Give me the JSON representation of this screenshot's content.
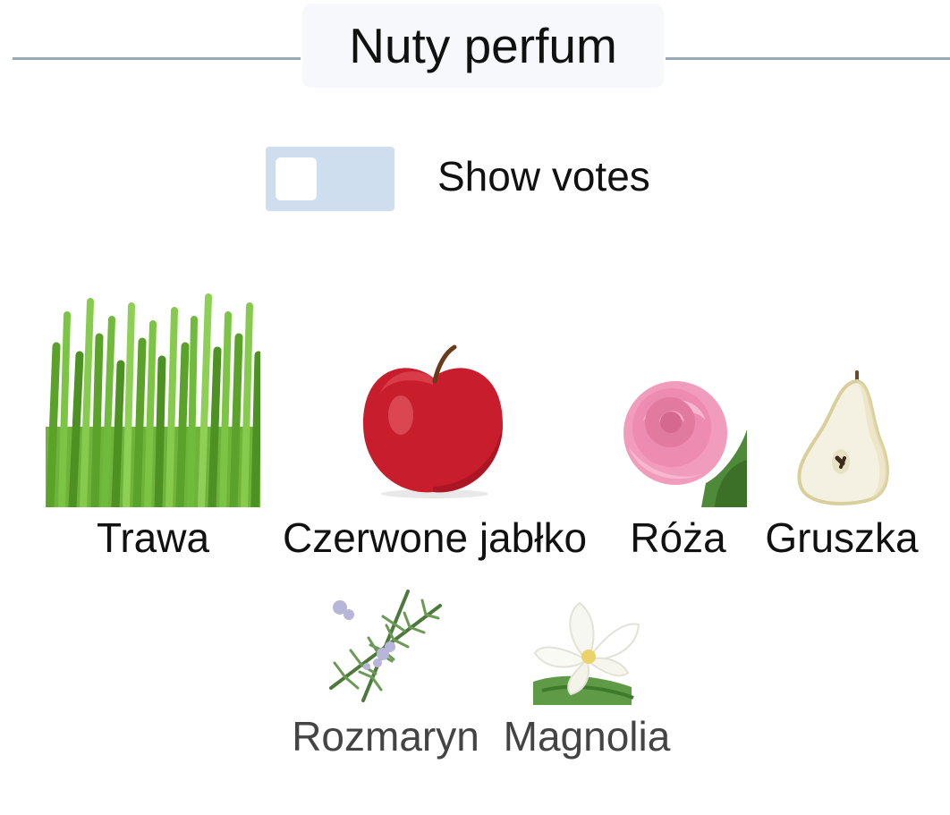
{
  "header": {
    "title": "Nuty perfum"
  },
  "controls": {
    "show_votes_label": "Show votes",
    "show_votes_on": false
  },
  "notes": [
    {
      "name": "Trawa",
      "icon": "grass-image"
    },
    {
      "name": "Czerwone jabłko",
      "icon": "red-apple-image"
    },
    {
      "name": "Róża",
      "icon": "rose-image"
    },
    {
      "name": "Gruszka",
      "icon": "pear-image"
    },
    {
      "name": "Rozmaryn",
      "icon": "rosemary-image"
    },
    {
      "name": "Magnolia",
      "icon": "magnolia-image"
    }
  ],
  "colors": {
    "rule": "#9aabb8",
    "title_bg": "#f6f8fc",
    "toggle_off": "#cfdeee"
  }
}
